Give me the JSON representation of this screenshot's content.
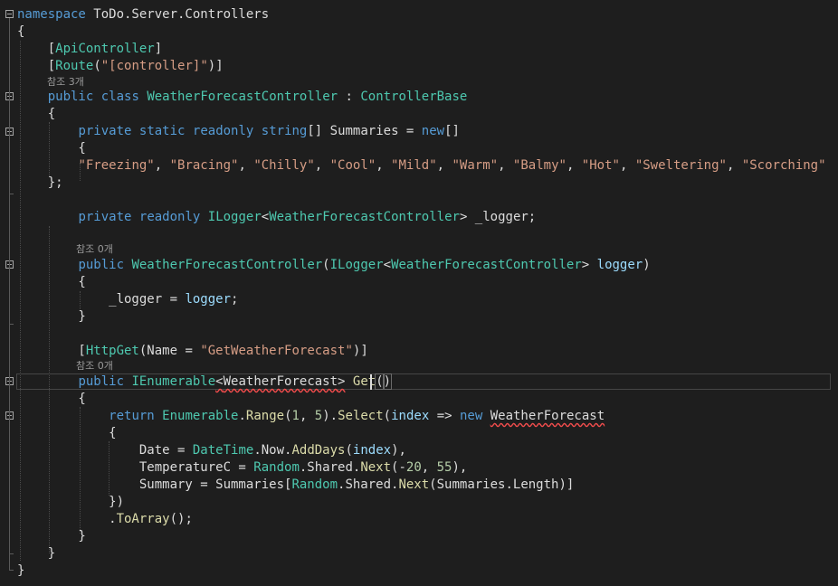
{
  "lines": [
    {
      "tokens": [
        {
          "t": "namespace",
          "c": "kw"
        },
        {
          "t": " ToDo.Server.Controllers"
        }
      ]
    },
    {
      "tokens": [
        {
          "t": "{"
        }
      ]
    },
    {
      "tokens": [
        {
          "t": "    ["
        },
        {
          "t": "ApiController",
          "c": "ty"
        },
        {
          "t": "]"
        }
      ]
    },
    {
      "tokens": [
        {
          "t": "    ["
        },
        {
          "t": "Route",
          "c": "ty"
        },
        {
          "t": "("
        },
        {
          "t": "\"[controller]\"",
          "c": "st"
        },
        {
          "t": ")]"
        }
      ]
    },
    {
      "lens": "참조 3개"
    },
    {
      "tokens": [
        {
          "t": "    "
        },
        {
          "t": "public",
          "c": "kw"
        },
        {
          "t": " "
        },
        {
          "t": "class",
          "c": "kw"
        },
        {
          "t": " "
        },
        {
          "t": "WeatherForecastController",
          "c": "ty"
        },
        {
          "t": " : "
        },
        {
          "t": "ControllerBase",
          "c": "ty"
        }
      ]
    },
    {
      "tokens": [
        {
          "t": "    {"
        }
      ]
    },
    {
      "tokens": [
        {
          "t": "        "
        },
        {
          "t": "private",
          "c": "kw"
        },
        {
          "t": " "
        },
        {
          "t": "static",
          "c": "kw"
        },
        {
          "t": " "
        },
        {
          "t": "readonly",
          "c": "kw"
        },
        {
          "t": " "
        },
        {
          "t": "string",
          "c": "kw"
        },
        {
          "t": "[] Summaries = "
        },
        {
          "t": "new",
          "c": "kw"
        },
        {
          "t": "[]"
        }
      ]
    },
    {
      "tokens": [
        {
          "t": "        {"
        }
      ]
    },
    {
      "tokens": [
        {
          "t": "        "
        },
        {
          "t": "\"Freezing\"",
          "c": "st"
        },
        {
          "t": ", "
        },
        {
          "t": "\"Bracing\"",
          "c": "st"
        },
        {
          "t": ", "
        },
        {
          "t": "\"Chilly\"",
          "c": "st"
        },
        {
          "t": ", "
        },
        {
          "t": "\"Cool\"",
          "c": "st"
        },
        {
          "t": ", "
        },
        {
          "t": "\"Mild\"",
          "c": "st"
        },
        {
          "t": ", "
        },
        {
          "t": "\"Warm\"",
          "c": "st"
        },
        {
          "t": ", "
        },
        {
          "t": "\"Balmy\"",
          "c": "st"
        },
        {
          "t": ", "
        },
        {
          "t": "\"Hot\"",
          "c": "st"
        },
        {
          "t": ", "
        },
        {
          "t": "\"Sweltering\"",
          "c": "st"
        },
        {
          "t": ", "
        },
        {
          "t": "\"Scorching\"",
          "c": "st"
        }
      ]
    },
    {
      "tokens": [
        {
          "t": "    };"
        }
      ]
    },
    {
      "tokens": []
    },
    {
      "tokens": [
        {
          "t": "        "
        },
        {
          "t": "private",
          "c": "kw"
        },
        {
          "t": " "
        },
        {
          "t": "readonly",
          "c": "kw"
        },
        {
          "t": " "
        },
        {
          "t": "ILogger",
          "c": "ty"
        },
        {
          "t": "<"
        },
        {
          "t": "WeatherForecastController",
          "c": "ty"
        },
        {
          "t": "> _logger;"
        }
      ]
    },
    {
      "tokens": []
    },
    {
      "lens": "참조 0개"
    },
    {
      "tokens": [
        {
          "t": "        "
        },
        {
          "t": "public",
          "c": "kw"
        },
        {
          "t": " "
        },
        {
          "t": "WeatherForecastController",
          "c": "ty"
        },
        {
          "t": "("
        },
        {
          "t": "ILogger",
          "c": "ty"
        },
        {
          "t": "<"
        },
        {
          "t": "WeatherForecastController",
          "c": "ty"
        },
        {
          "t": "> "
        },
        {
          "t": "logger",
          "c": "pa"
        },
        {
          "t": ")"
        }
      ]
    },
    {
      "tokens": [
        {
          "t": "        {"
        }
      ]
    },
    {
      "tokens": [
        {
          "t": "            _logger = "
        },
        {
          "t": "logger",
          "c": "pa"
        },
        {
          "t": ";"
        }
      ]
    },
    {
      "tokens": [
        {
          "t": "        }"
        }
      ]
    },
    {
      "tokens": []
    },
    {
      "tokens": [
        {
          "t": "        ["
        },
        {
          "t": "HttpGet",
          "c": "ty"
        },
        {
          "t": "(Name = "
        },
        {
          "t": "\"GetWeatherForecast\"",
          "c": "st"
        },
        {
          "t": ")]"
        }
      ]
    },
    {
      "lens": "참조 0개"
    },
    {
      "tokens": [
        {
          "t": "        "
        },
        {
          "t": "public",
          "c": "kw"
        },
        {
          "t": " "
        },
        {
          "t": "IEnumerable",
          "c": "ty"
        },
        {
          "t": "<",
          "c": "squig"
        },
        {
          "t": "WeatherForecast",
          "c": "squig"
        },
        {
          "t": ">",
          "c": "squig"
        },
        {
          "t": " "
        },
        {
          "t": "Get",
          "c": "me"
        },
        {
          "t": "(",
          "c": "brk"
        },
        {
          "t": ")",
          "c": "brk"
        }
      ]
    },
    {
      "tokens": [
        {
          "t": "        {"
        }
      ]
    },
    {
      "tokens": [
        {
          "t": "            "
        },
        {
          "t": "return",
          "c": "kw"
        },
        {
          "t": " "
        },
        {
          "t": "Enumerable",
          "c": "ty"
        },
        {
          "t": "."
        },
        {
          "t": "Range",
          "c": "me"
        },
        {
          "t": "("
        },
        {
          "t": "1",
          "c": "nu"
        },
        {
          "t": ", "
        },
        {
          "t": "5",
          "c": "nu"
        },
        {
          "t": ")."
        },
        {
          "t": "Select",
          "c": "me"
        },
        {
          "t": "("
        },
        {
          "t": "index",
          "c": "pa"
        },
        {
          "t": " => "
        },
        {
          "t": "new",
          "c": "kw"
        },
        {
          "t": " "
        },
        {
          "t": "WeatherForecast",
          "c": "squig"
        }
      ]
    },
    {
      "tokens": [
        {
          "t": "            {"
        }
      ]
    },
    {
      "tokens": [
        {
          "t": "                Date = "
        },
        {
          "t": "DateTime",
          "c": "ty"
        },
        {
          "t": ".Now."
        },
        {
          "t": "AddDays",
          "c": "me"
        },
        {
          "t": "("
        },
        {
          "t": "index",
          "c": "pa"
        },
        {
          "t": "),"
        }
      ]
    },
    {
      "tokens": [
        {
          "t": "                TemperatureC = "
        },
        {
          "t": "Random",
          "c": "ty"
        },
        {
          "t": ".Shared."
        },
        {
          "t": "Next",
          "c": "me"
        },
        {
          "t": "(-"
        },
        {
          "t": "20",
          "c": "nu"
        },
        {
          "t": ", "
        },
        {
          "t": "55",
          "c": "nu"
        },
        {
          "t": "),"
        }
      ]
    },
    {
      "tokens": [
        {
          "t": "                Summary = Summaries["
        },
        {
          "t": "Random",
          "c": "ty"
        },
        {
          "t": ".Shared."
        },
        {
          "t": "Next",
          "c": "me"
        },
        {
          "t": "(Summaries.Length)]"
        }
      ]
    },
    {
      "tokens": [
        {
          "t": "            })"
        }
      ]
    },
    {
      "tokens": [
        {
          "t": "            ."
        },
        {
          "t": "ToArray",
          "c": "me"
        },
        {
          "t": "();"
        }
      ]
    },
    {
      "tokens": [
        {
          "t": "        }"
        }
      ]
    },
    {
      "tokens": [
        {
          "t": "    }"
        }
      ]
    },
    {
      "tokens": [
        {
          "t": "}"
        }
      ]
    }
  ]
}
